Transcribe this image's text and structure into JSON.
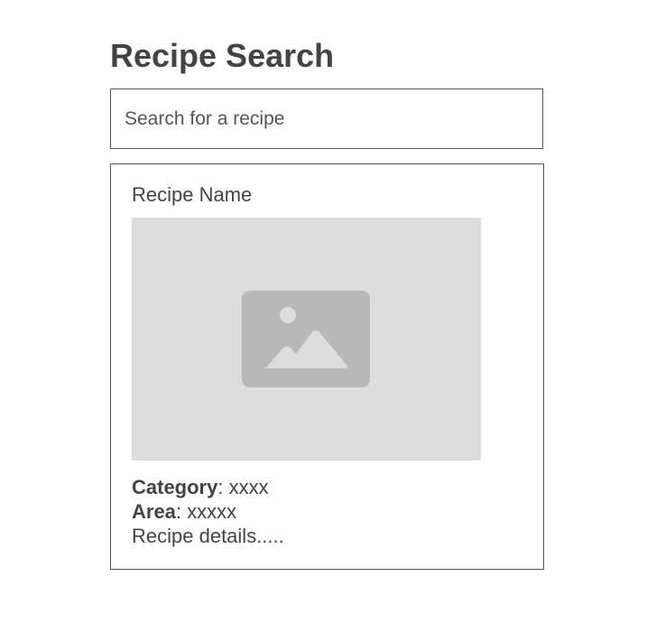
{
  "page": {
    "title": "Recipe Search"
  },
  "search": {
    "placeholder": "Search for a recipe",
    "value": ""
  },
  "recipe": {
    "name": "Recipe Name",
    "image_icon": "image-placeholder-icon",
    "category_label": "Category",
    "category_value": ": xxxx",
    "area_label": "Area",
    "area_value": ": xxxxx",
    "details": "Recipe details....."
  },
  "colors": {
    "text": "#444444",
    "border": "#555555",
    "image_bg": "#dddddd",
    "icon_bg": "#b8b8b8",
    "icon_fg": "#dddddd"
  }
}
